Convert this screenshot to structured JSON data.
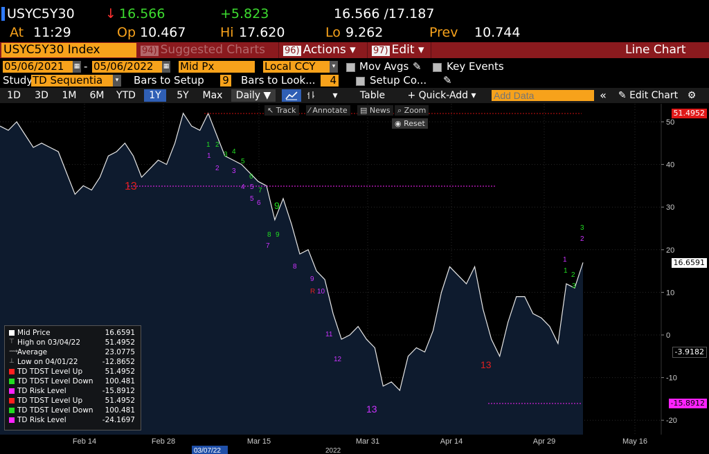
{
  "quote": {
    "ticker": "USYC5Y30",
    "arrow": "↓",
    "last": "16.566",
    "change": "+5.823",
    "bid_ask": "16.566 /17.187",
    "at_label": "At",
    "time": "11:29",
    "op_label": "Op",
    "open": "10.467",
    "hi_label": "Hi",
    "high": "17.620",
    "lo_label": "Lo",
    "low": "9.262",
    "prev_label": "Prev",
    "prev": "10.744"
  },
  "titlebar": {
    "security": "USYC5Y30 Index",
    "suggested_num": "94)",
    "suggested_label": "Suggested Charts",
    "actions_num": "96)",
    "actions_label": "Actions ▾",
    "edit_num": "97)",
    "edit_label": "Edit ▾",
    "chart_type": "Line Chart"
  },
  "controls": {
    "start_date": "05/06/2021",
    "end_date": "05/06/2022",
    "price_field": "Mid Px",
    "currency": "Local CCY",
    "mov_avgs": "Mov Avgs",
    "key_events": "Key Events",
    "study_label": "Study",
    "study_value": "TD Sequentia",
    "bars_setup_label": "Bars to Setup",
    "bars_setup_value": "9",
    "bars_look_label": "Bars to Look...",
    "bars_look_value": "4",
    "setup_co_label": "Setup Co..."
  },
  "toolbar": {
    "periods": [
      "1D",
      "3D",
      "1M",
      "6M",
      "YTD",
      "1Y",
      "5Y",
      "Max"
    ],
    "active_period": "1Y",
    "frequency": "Daily ▼",
    "table": "Table",
    "quick_add": "+ Quick-Add ▾",
    "add_data_placeholder": "Add Data",
    "collapse": "«",
    "edit_chart": "✎ Edit Chart",
    "gear": "⚙"
  },
  "chart_tools": {
    "track": "Track",
    "annotate": "Annotate",
    "news": "News",
    "zoom": "Zoom",
    "reset": "Reset"
  },
  "chart_data": {
    "type": "area",
    "x_ticks": [
      "Feb 14",
      "Feb 28",
      "Mar 15",
      "Mar 31",
      "Apr 14",
      "Apr 29",
      "May 16"
    ],
    "cursor_date": "03/07/22",
    "year_label": "2022",
    "y_ticks": [
      50,
      40,
      30,
      20,
      10,
      0,
      -10,
      -20
    ],
    "ylim": [
      -23,
      53
    ],
    "series": [
      {
        "name": "Mid Price",
        "values": [
          49,
          48,
          50,
          47,
          44,
          45,
          44,
          43,
          38,
          33,
          35,
          34,
          37,
          42,
          43,
          45,
          42,
          37,
          39,
          41,
          40,
          45,
          52,
          49,
          48,
          52,
          47,
          42,
          41,
          40,
          38,
          36,
          35,
          27,
          32,
          26,
          19,
          20,
          15,
          13,
          5,
          -1,
          0,
          2,
          -1,
          -3,
          -12,
          -11,
          -13,
          -5,
          -3,
          -4,
          1,
          10,
          16,
          14,
          12,
          16,
          6,
          -1,
          -5,
          3,
          9,
          9,
          5,
          4,
          2,
          -2,
          12,
          11,
          17
        ]
      }
    ],
    "last_price_label": "16.6591",
    "tdst_up_label": "51.4952",
    "tdst_down_label": "-3.9182",
    "risk_label": "-15.8912"
  },
  "legend": [
    {
      "name": "Mid Price",
      "value": "16.6591",
      "color": "#ffffff",
      "kind": "square"
    },
    {
      "name": "High on 03/04/22",
      "value": "51.4952",
      "color": "#aaaaaa",
      "kind": "hi"
    },
    {
      "name": "Average",
      "value": "23.0775",
      "color": "#aaaaaa",
      "kind": "avg"
    },
    {
      "name": "Low on 04/01/22",
      "value": "-12.8652",
      "color": "#aaaaaa",
      "kind": "lo"
    },
    {
      "name": "TD TDST Level Up",
      "value": "51.4952",
      "color": "#ff2020",
      "kind": "square"
    },
    {
      "name": "TD TDST Level Down",
      "value": "100.481",
      "color": "#22dd22",
      "kind": "square"
    },
    {
      "name": "TD Risk Level",
      "value": "-15.8912",
      "color": "#ff22ff",
      "kind": "square"
    },
    {
      "name": "TD TDST Level Up",
      "value": "51.4952",
      "color": "#ff2020",
      "kind": "square"
    },
    {
      "name": "TD TDST Level Down",
      "value": "100.481",
      "color": "#22dd22",
      "kind": "square"
    },
    {
      "name": "TD Risk Level",
      "value": "-24.1697",
      "color": "#ff22ff",
      "kind": "square"
    }
  ],
  "colors": {
    "accent": "#f7a21b",
    "title_bar": "#8b1a1e",
    "up": "#3ddc2f",
    "down": "#ff3030",
    "fill": "#0e1b2e"
  }
}
